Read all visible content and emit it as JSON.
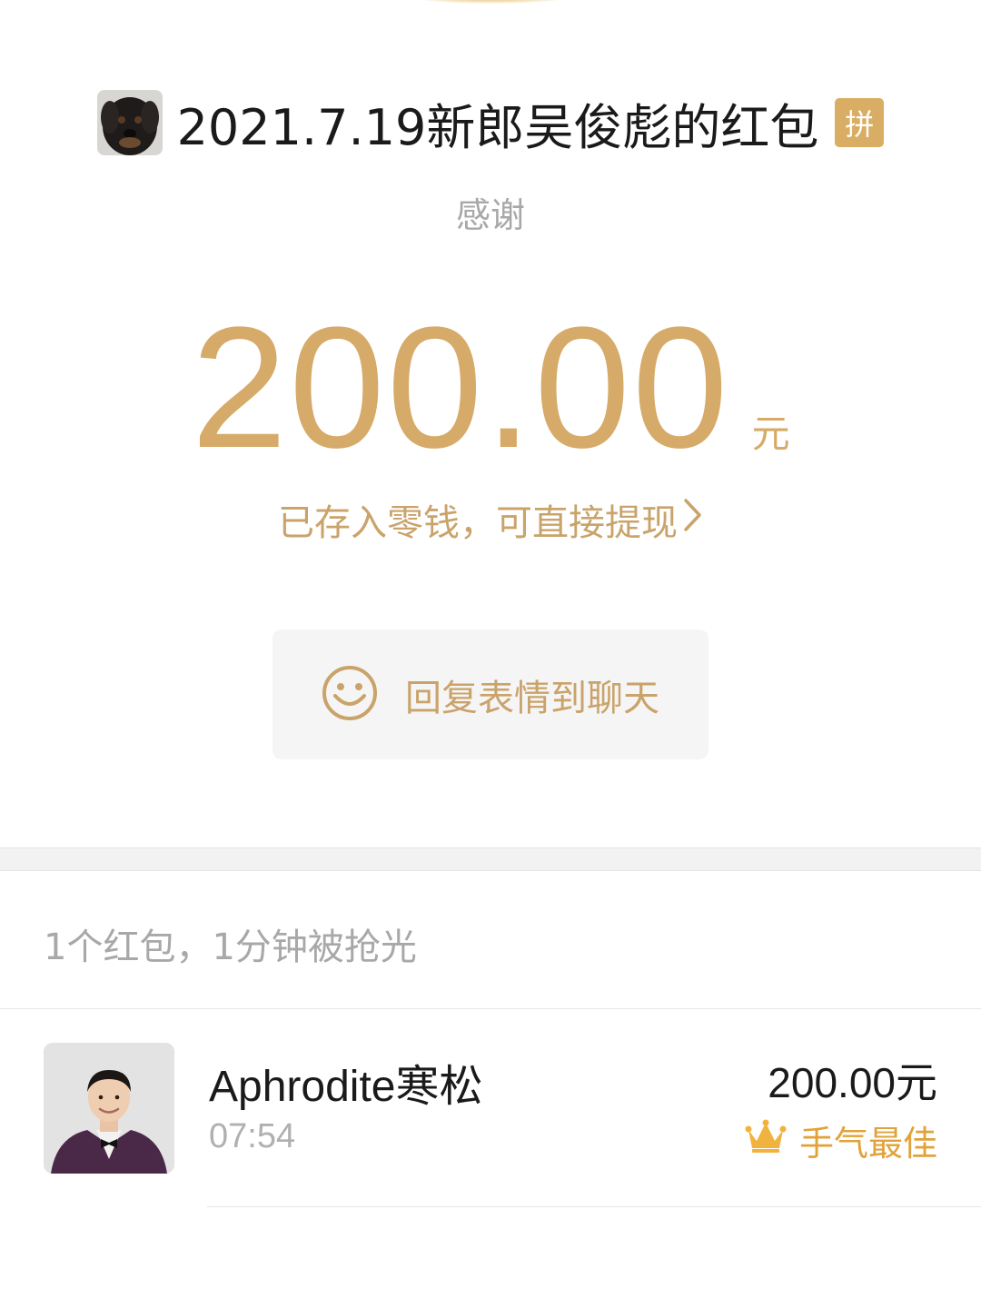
{
  "packet": {
    "title": "2021.7.19新郎吴俊彪的红包",
    "pin_badge": "拼",
    "greeting": "感谢",
    "amount": "200.00",
    "unit": "元",
    "wallet_link": "已存入零钱，可直接提现",
    "reply_button": "回复表情到聊天"
  },
  "summary": "1个红包，1分钟被抢光",
  "receivers": [
    {
      "name": "Aphrodite寒松",
      "time": "07:54",
      "amount": "200.00元",
      "badge": "手气最佳"
    }
  ],
  "icons": {
    "sender_avatar": "dog-photo-avatar",
    "reply": "smiley-icon",
    "wallet_link": "chevron-right-icon",
    "badge": "crown-icon",
    "receiver_avatar": "man-in-suit-photo-avatar"
  },
  "colors": {
    "gold": "#d6aa68",
    "gold_text": "#c9a36a",
    "badge": "#d9ae64",
    "best_luck": "#e2a23a"
  }
}
